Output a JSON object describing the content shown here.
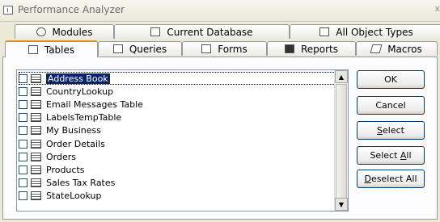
{
  "window": {
    "title": "Performance Analyzer",
    "close_glyph": "x"
  },
  "tabs_back": [
    {
      "label": "Modules",
      "icon": "modules-icon"
    },
    {
      "label": "Current Database",
      "icon": "database-icon"
    },
    {
      "label": "All Object Types",
      "icon": "object-types-icon"
    }
  ],
  "tabs_front": [
    {
      "label": "Tables",
      "icon": "table-icon",
      "active": true
    },
    {
      "label": "Queries",
      "icon": "queries-icon"
    },
    {
      "label": "Forms",
      "icon": "forms-icon"
    },
    {
      "label": "Reports",
      "icon": "reports-icon"
    },
    {
      "label": "Macros",
      "icon": "macros-icon"
    }
  ],
  "list": {
    "items": [
      "Address Book",
      "CountryLookup",
      "Email Messages Table",
      "LabelsTempTable",
      "My Business",
      "Order Details",
      "Orders",
      "Products",
      "Sales Tax Rates",
      "StateLookup"
    ],
    "selected_index": 0
  },
  "buttons": {
    "ok": "OK",
    "cancel": "Cancel",
    "select_prefix": "",
    "select_underline": "S",
    "select_rest": "elect",
    "select_all_prefix": "Select ",
    "select_all_underline": "A",
    "select_all_rest": "ll",
    "deselect_all_prefix": "",
    "deselect_all_underline": "D",
    "deselect_all_rest": "eselect All"
  }
}
